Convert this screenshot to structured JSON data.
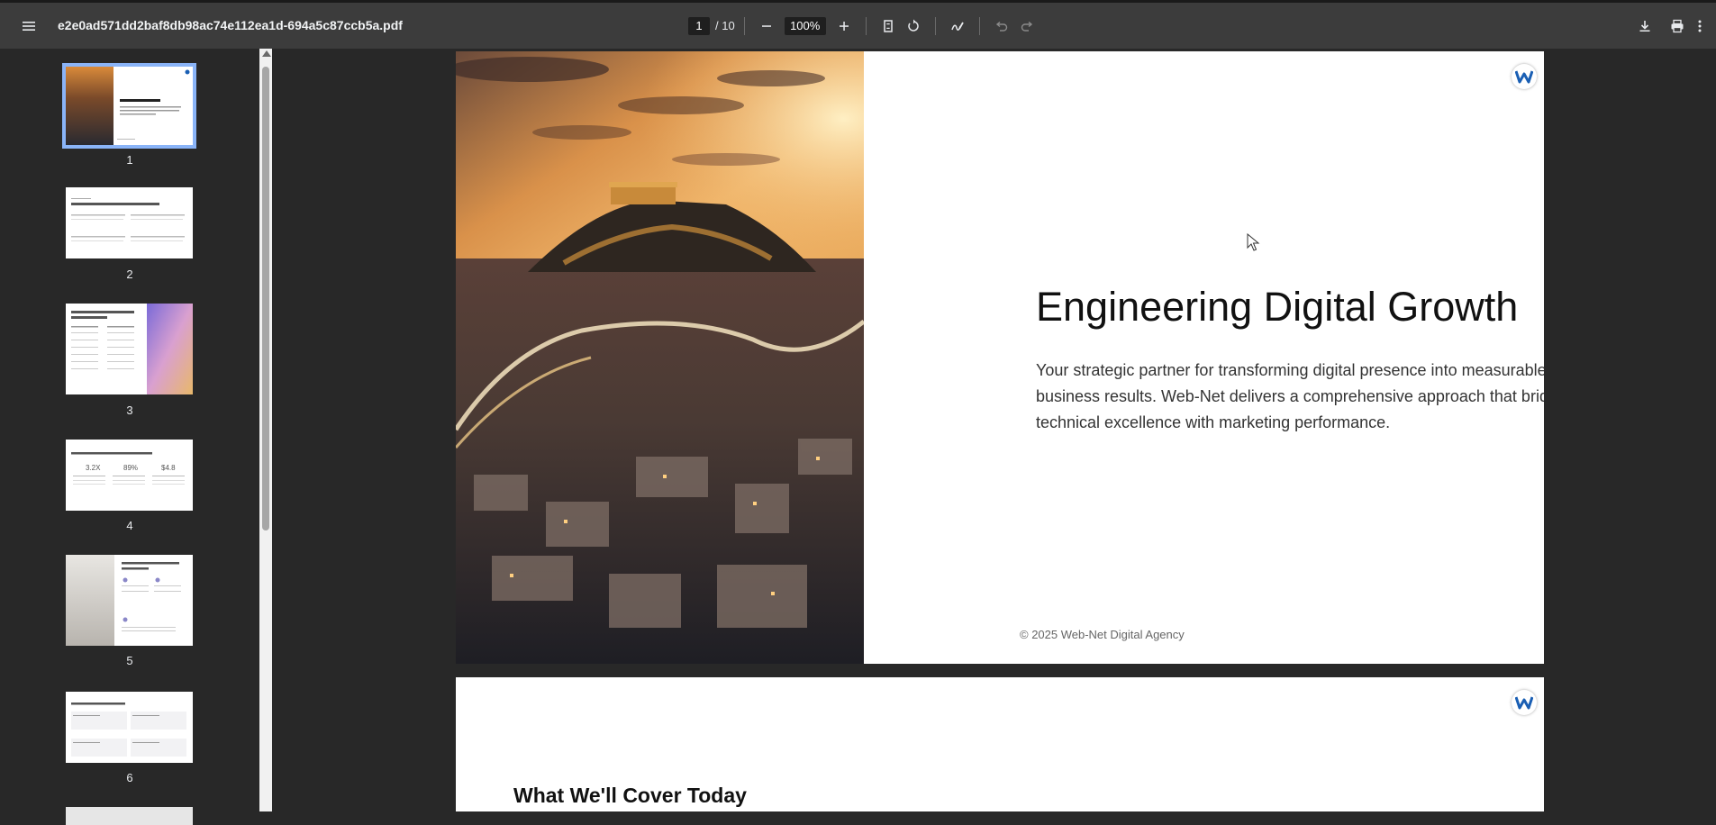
{
  "toolbar": {
    "filename": "e2e0ad571dd2baf8db98ac74e112ea1d-694a5c87ccb5a.pdf",
    "current_page": "1",
    "total_pages": "/ 10",
    "zoom": "100%"
  },
  "thumbnails": [
    {
      "num": "1",
      "title": "Engineering Digital Growth",
      "selected": true
    },
    {
      "num": "2",
      "title": "The Web-Net One Stop Shop Advantage"
    },
    {
      "num": "3",
      "title": "Performance Marketing That Delivers Results"
    },
    {
      "num": "4",
      "title": "Why Video Advertising Drives Growth",
      "stats": [
        "3.2X",
        "89%",
        "$4.8"
      ]
    },
    {
      "num": "5",
      "title": "Technical Excellence: Your Digital Foundation"
    },
    {
      "num": "6",
      "title": "Technical Services = Business Benefits"
    }
  ],
  "page1": {
    "title": "Engineering Digital Growth",
    "description": "Your strategic partner for transforming digital presence into measurable business results. Web-Net delivers a comprehensive approach that bridges technical excellence with marketing performance.",
    "footer": "© 2025 Web-Net Digital Agency"
  },
  "page2": {
    "title": "What We'll Cover Today"
  },
  "colors": {
    "toolbar_bg": "#3c3c3c",
    "viewer_bg": "#282828",
    "selection": "#8ab4f8",
    "logo_blue": "#1a5fb4"
  }
}
